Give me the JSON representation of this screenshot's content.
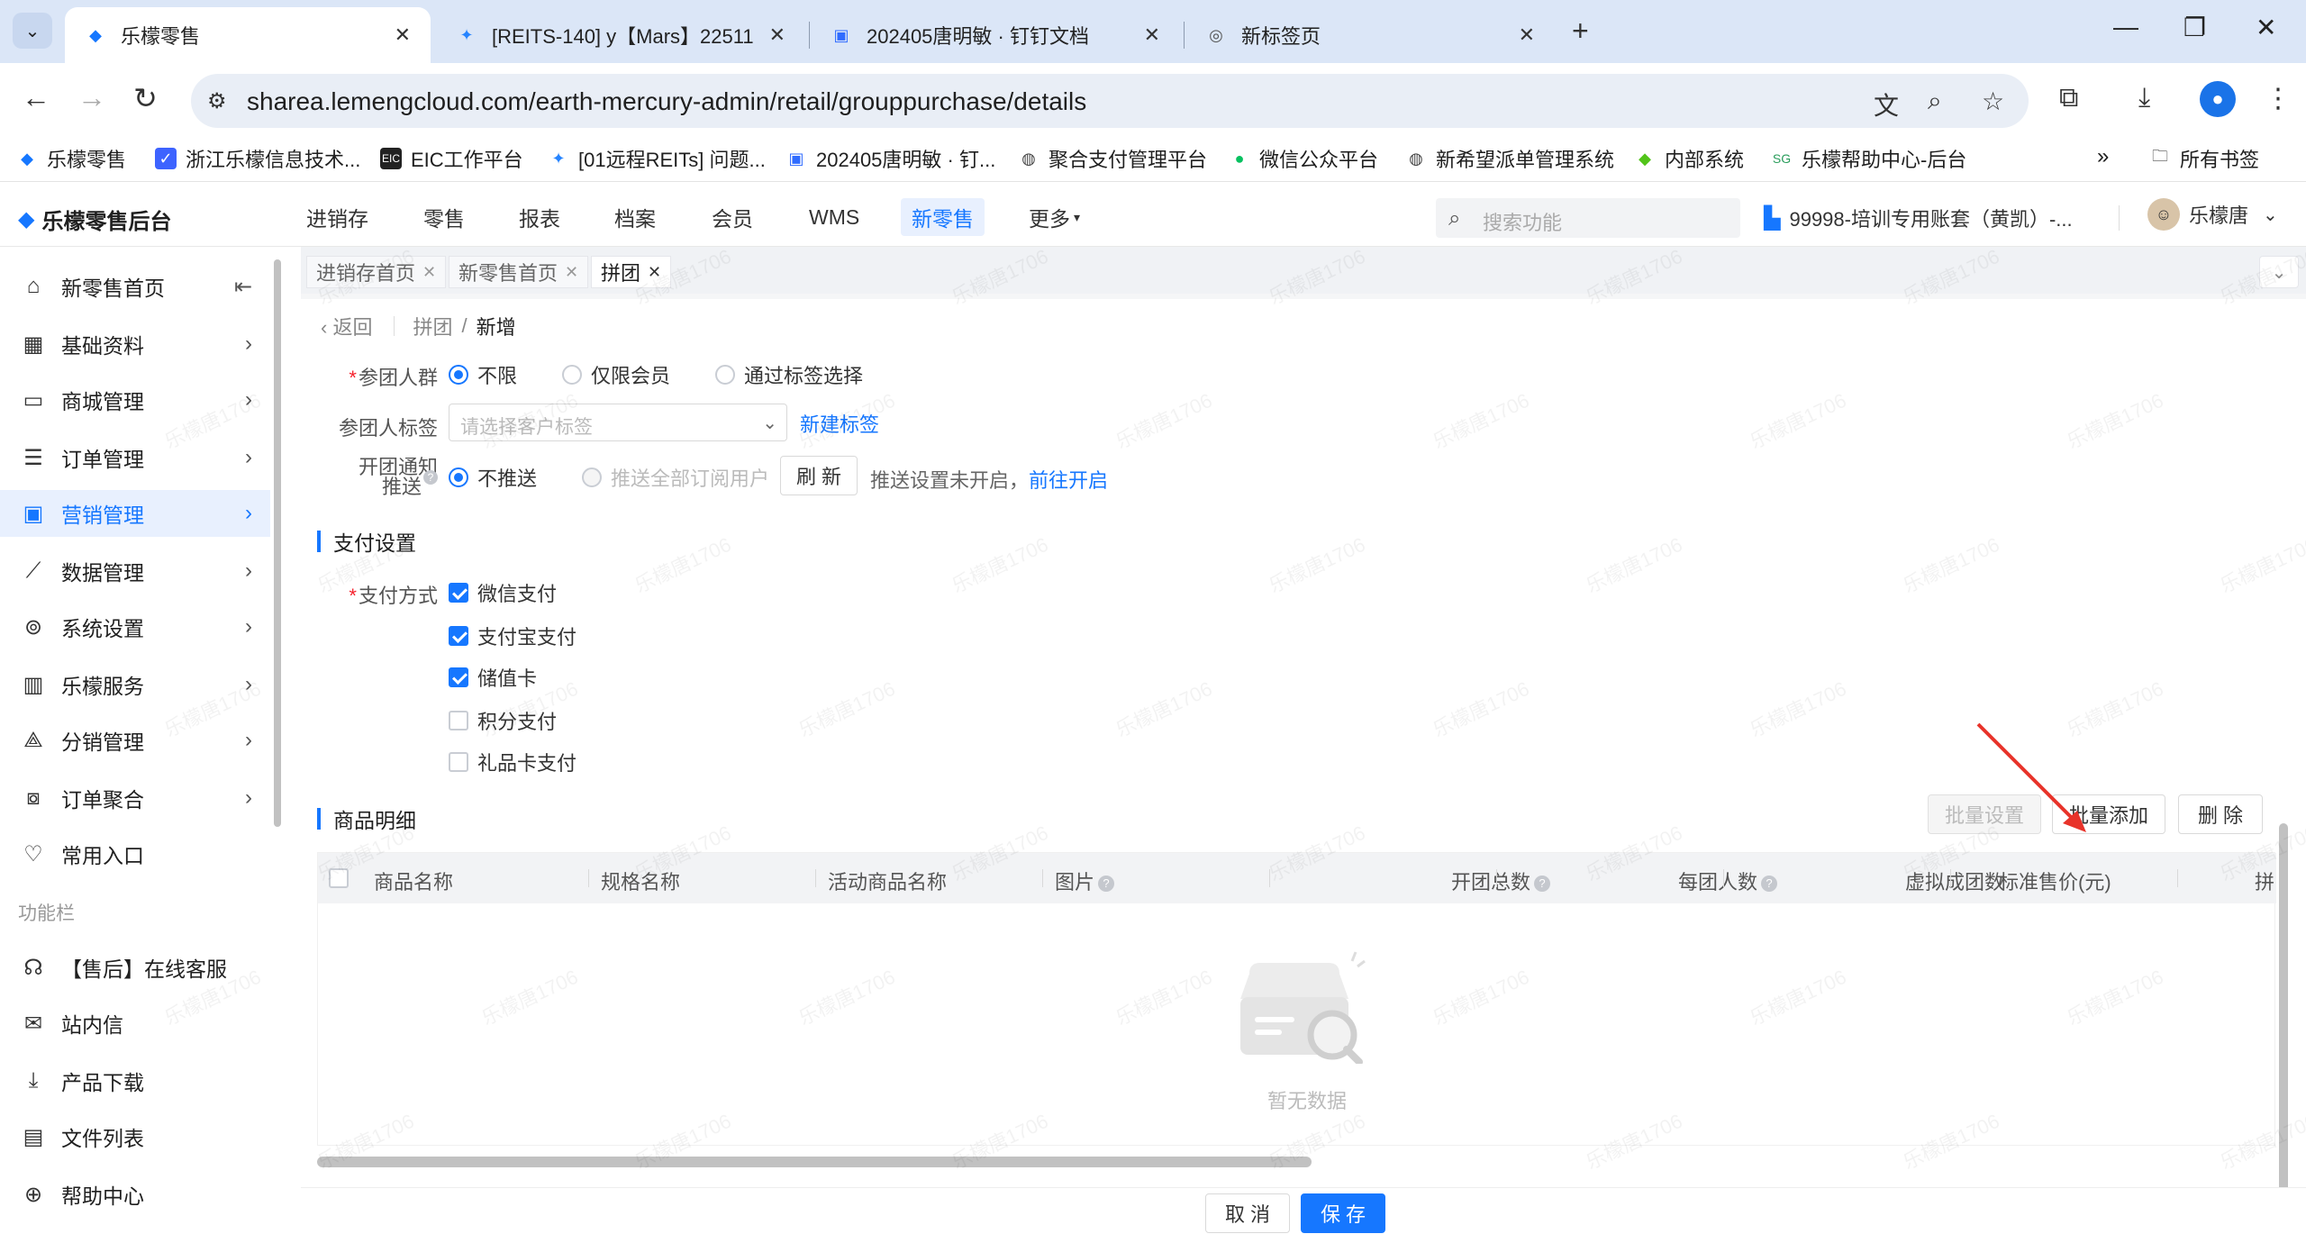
{
  "browser": {
    "tabs": [
      {
        "title": "乐檬零售",
        "active": true,
        "icon": "lemeng-icon"
      },
      {
        "title": "[REITS-140] y【Mars】22511",
        "active": false,
        "icon": "jira-icon"
      },
      {
        "title": "202405唐明敏 · 钉钉文档",
        "active": false,
        "icon": "doc-icon"
      },
      {
        "title": "新标签页",
        "active": false,
        "icon": "chrome-icon"
      }
    ],
    "url": "sharea.lemengcloud.com/earth-mercury-admin/retail/grouppurchase/details",
    "bookmarks": [
      {
        "label": "乐檬零售",
        "icon": "lemeng-icon"
      },
      {
        "label": "浙江乐檬信息技术...",
        "icon": "lemeng-blue-icon"
      },
      {
        "label": "EIC工作平台",
        "icon": "eic-icon"
      },
      {
        "label": "[01远程REITs] 问题...",
        "icon": "jira-icon"
      },
      {
        "label": "202405唐明敏 · 钉...",
        "icon": "doc-icon"
      },
      {
        "label": "聚合支付管理平台",
        "icon": "globe-icon"
      },
      {
        "label": "微信公众平台",
        "icon": "wechat-icon"
      },
      {
        "label": "新希望派单管理系统",
        "icon": "globe-icon"
      },
      {
        "label": "内部系统",
        "icon": "lemeng-icon"
      },
      {
        "label": "乐檬帮助中心-后台",
        "icon": "help-icon"
      }
    ],
    "all_bookmarks": "所有书签"
  },
  "app": {
    "brand": "乐檬零售后台",
    "nav": [
      "进销存",
      "零售",
      "报表",
      "档案",
      "会员",
      "WMS",
      "新零售",
      "更多"
    ],
    "nav_active": "新零售",
    "search_placeholder": "搜索功能",
    "account": "99998-培训专用账套（黄凯）-...",
    "user": "乐檬唐"
  },
  "sidebar": {
    "items": [
      {
        "label": "新零售首页",
        "icon": "home-icon"
      },
      {
        "label": "基础资料",
        "icon": "grid-icon"
      },
      {
        "label": "商城管理",
        "icon": "shop-icon"
      },
      {
        "label": "订单管理",
        "icon": "order-icon"
      },
      {
        "label": "营销管理",
        "icon": "marketing-icon",
        "active": true
      },
      {
        "label": "数据管理",
        "icon": "chart-icon"
      },
      {
        "label": "系统设置",
        "icon": "settings-icon"
      },
      {
        "label": "乐檬服务",
        "icon": "service-icon"
      },
      {
        "label": "分销管理",
        "icon": "distribution-icon"
      },
      {
        "label": "订单聚合",
        "icon": "aggregate-icon"
      },
      {
        "label": "常用入口",
        "icon": "heart-icon"
      }
    ],
    "group_label": "功能栏",
    "tools": [
      {
        "label": "【售后】在线客服",
        "icon": "headset-icon"
      },
      {
        "label": "站内信",
        "icon": "mail-icon"
      },
      {
        "label": "产品下载",
        "icon": "download-icon"
      },
      {
        "label": "文件列表",
        "icon": "file-list-icon"
      },
      {
        "label": "帮助中心",
        "icon": "help-icon"
      }
    ]
  },
  "page_tabs": [
    {
      "label": "进销存首页",
      "active": false
    },
    {
      "label": "新零售首页",
      "active": false
    },
    {
      "label": "拼团",
      "active": true
    }
  ],
  "breadcrumb": {
    "back": "返回",
    "parent": "拼团",
    "current": "新增"
  },
  "form": {
    "crowd": {
      "label": "参团人群",
      "options": [
        "不限",
        "仅限会员",
        "通过标签选择"
      ],
      "selected": "不限"
    },
    "tag": {
      "label": "参团人标签",
      "placeholder": "请选择客户标签",
      "new_tag": "新建标签"
    },
    "notify": {
      "label_line1": "开团通知",
      "label_line2": "推送",
      "options": [
        "不推送",
        "推送全部订阅用户"
      ],
      "selected": "不推送",
      "refresh": "刷 新",
      "hint": "推送设置未开启，",
      "hint_link": "前往开启"
    }
  },
  "payment": {
    "section_title": "支付设置",
    "label": "支付方式",
    "methods": [
      {
        "label": "微信支付",
        "checked": true
      },
      {
        "label": "支付宝支付",
        "checked": true
      },
      {
        "label": "储值卡",
        "checked": true
      },
      {
        "label": "积分支付",
        "checked": false
      },
      {
        "label": "礼品卡支付",
        "checked": false
      }
    ]
  },
  "goods": {
    "section_title": "商品明细",
    "buttons": {
      "batch_set": "批量设置",
      "batch_add": "批量添加",
      "delete": "删 除"
    },
    "columns": [
      "商品名称",
      "规格名称",
      "活动商品名称",
      "图片",
      "开团总数",
      "每团人数",
      "虚拟成团数",
      "标准售价(元)",
      "拼"
    ],
    "empty": "暂无数据"
  },
  "footer": {
    "cancel": "取 消",
    "save": "保 存"
  },
  "colors": {
    "primary": "#1677ff",
    "annotation_arrow": "#e8332a"
  },
  "watermark": "乐檬唐1706"
}
